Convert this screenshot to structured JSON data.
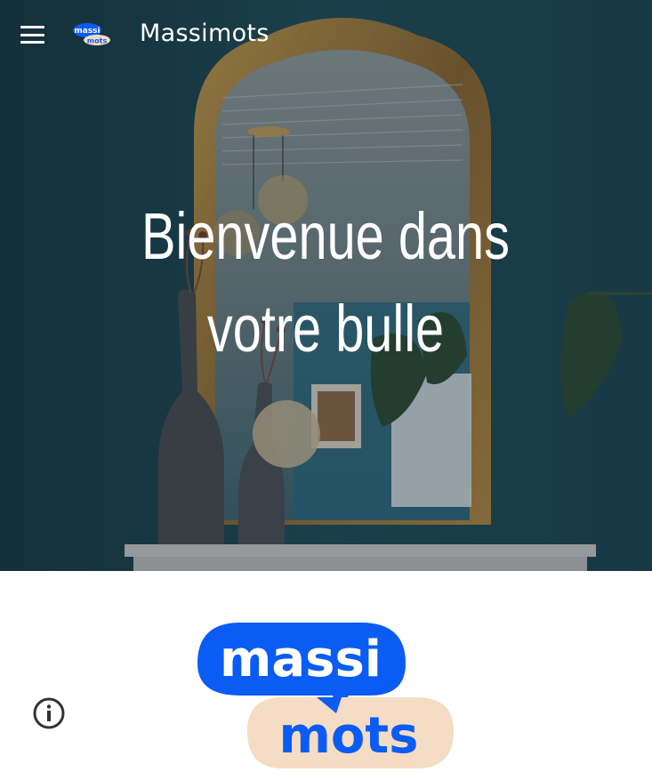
{
  "header": {
    "site_name": "Massimots",
    "logo_line1": "massi",
    "logo_line2": "mots"
  },
  "hero": {
    "title": "Bienvenue dans votre bulle"
  },
  "logo": {
    "line1": "massi",
    "line2": "mots",
    "colors": {
      "blue": "#0a5cf5",
      "peach": "#f5dcc4"
    }
  },
  "icons": {
    "menu": "hamburger-menu-icon",
    "info": "info-icon"
  }
}
